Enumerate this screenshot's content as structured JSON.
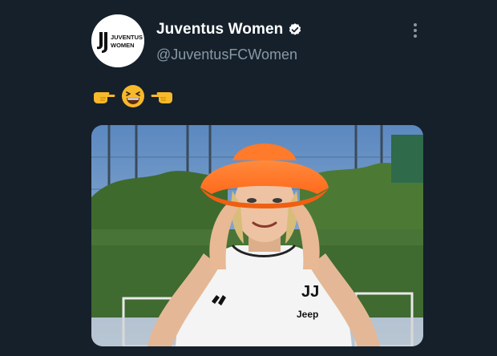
{
  "tweet": {
    "author": {
      "display_name": "Juventus Women",
      "handle": "@JuventusFCWomen",
      "verified": true,
      "avatar_text": "JUVENTUS WOMEN",
      "avatar_logo": "JJ"
    },
    "text_emojis": [
      "point-right-emoji",
      "laughing-face-emoji",
      "point-left-emoji"
    ],
    "media": {
      "type": "photo",
      "shirt_brand": "Jeep"
    },
    "more_icon": "more-vertical-icon"
  },
  "colors": {
    "background": "#15202b",
    "secondary_text": "#8899a6",
    "verified_badge": "#ffffff",
    "hat": "#ff7a2a"
  }
}
